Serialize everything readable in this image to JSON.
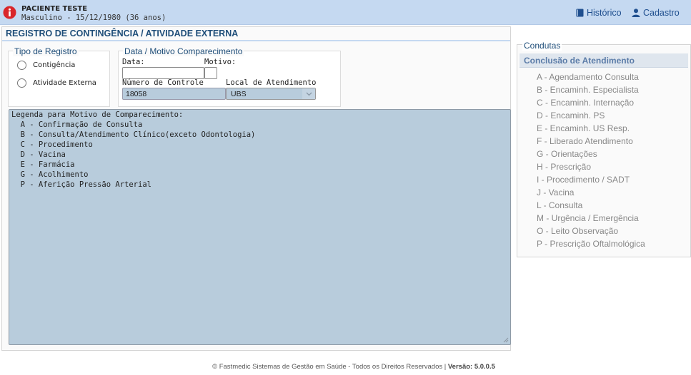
{
  "patient": {
    "name": "PACIENTE TESTE",
    "subtitle": "Masculino - 15/12/1980 (36 anos)"
  },
  "header_links": {
    "historico": "Histórico",
    "cadastro": "Cadastro"
  },
  "page_title": "REGISTRO DE CONTINGÊNCIA / ATIVIDADE EXTERNA",
  "tipo_registro": {
    "legend": "Tipo de Registro",
    "options": [
      "Contigência",
      "Atividade Externa"
    ]
  },
  "data_motivo": {
    "legend": "Data / Motivo Comparecimento",
    "data_label": "Data:",
    "data_value": "",
    "motivo_label": "Motivo:",
    "motivo_value": "",
    "numero_controle_label": "Número de Controle",
    "numero_controle_value": "18058",
    "local_label": "Local de Atendimento",
    "local_value": "UBS"
  },
  "legenda_text": [
    "Legenda para Motivo de Comparecimento:",
    "  A - Confirmação de Consulta",
    "  B - Consulta/Atendimento Clínico(exceto Odontologia)",
    "  C - Procedimento",
    "  D - Vacina",
    "  E - Farmácia",
    "  G - Acolhimento",
    "  P - Aferição Pressão Arterial"
  ],
  "condutas": {
    "title": "Condutas",
    "header": "Conclusão de Atendimento",
    "items": [
      "A - Agendamento Consulta",
      "B - Encaminh. Especialista",
      "C - Encaminh. Internação",
      "D - Encaminh. PS",
      "E - Encaminh. US Resp.",
      "F - Liberado Atendimento",
      "G - Orientações",
      "H - Prescrição",
      "I - Procedimento / SADT",
      "J - Vacina",
      "L - Consulta",
      "M - Urgência / Emergência",
      "O - Leito Observação",
      "P - Prescrição Oftalmológica"
    ]
  },
  "footer": {
    "text": "© Fastmedic Sistemas de Gestão em Saúde - Todos os Direitos Reservados | ",
    "version": "Versão: 5.0.0.5"
  },
  "colors": {
    "header_bg": "#c5d9f1",
    "title_blue": "#1f4e79",
    "textarea_bg": "#b8ccdc",
    "info_red": "#d9262b"
  },
  "icons": [
    "info-icon",
    "book-icon",
    "user-icon",
    "chevron-down-icon"
  ]
}
